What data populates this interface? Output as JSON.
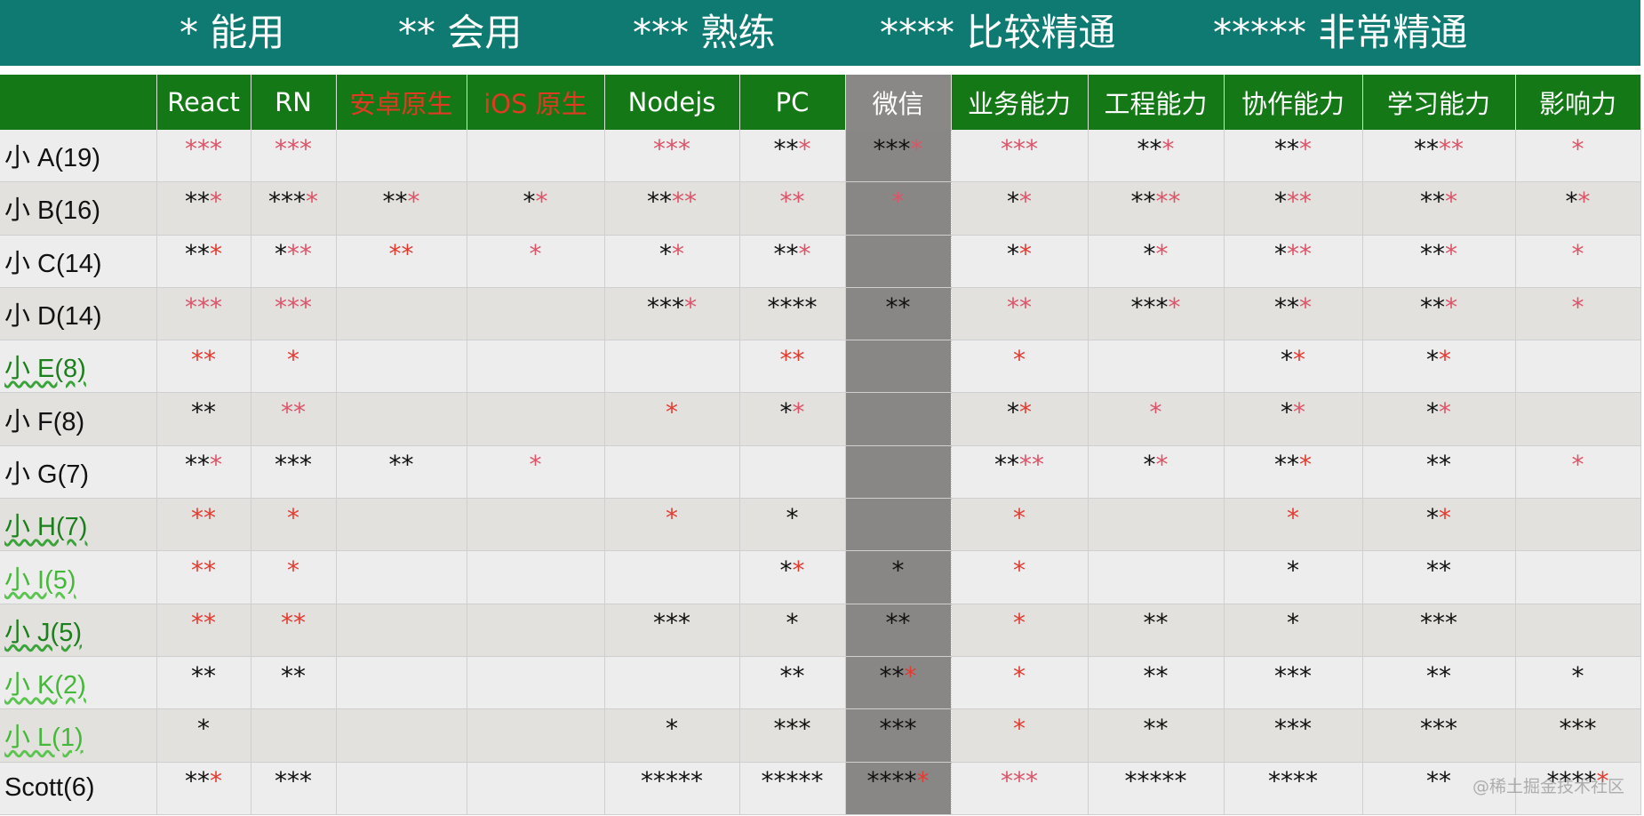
{
  "legend": [
    "* 能用",
    "** 会用",
    "*** 熟练",
    "**** 比较精通",
    "***** 非常精通"
  ],
  "columns": [
    {
      "label": "",
      "color": "white"
    },
    {
      "label": "React",
      "color": "white"
    },
    {
      "label": "RN",
      "color": "white"
    },
    {
      "label": "安卓原生",
      "color": "red"
    },
    {
      "label": "iOS 原生",
      "color": "red"
    },
    {
      "label": "Nodejs",
      "color": "white"
    },
    {
      "label": "PC",
      "color": "white"
    },
    {
      "label": "微信",
      "color": "white"
    },
    {
      "label": "业务能力",
      "color": "white"
    },
    {
      "label": "工程能力",
      "color": "white"
    },
    {
      "label": "协作能力",
      "color": "white"
    },
    {
      "label": "学习能力",
      "color": "white"
    },
    {
      "label": "影响力",
      "color": "white"
    }
  ],
  "star_color_legend": {
    "b": "#111111",
    "r": "#e33b30",
    "p": "#dc5468"
  },
  "rows": [
    {
      "name": "小 A(19)",
      "name_style": "black",
      "cells": [
        "ppp",
        "ppp",
        "",
        "",
        "ppp",
        "bbp",
        "bbbp",
        "ppp",
        "bbp",
        "bbp",
        "bbpp",
        "p"
      ]
    },
    {
      "name": "小 B(16)",
      "name_style": "black",
      "cells": [
        "bbp",
        "bbbp",
        "bbp",
        "bp",
        "bbpp",
        "pp",
        "p",
        "bp",
        "bbpp",
        "bpp",
        "bbp",
        "bp"
      ]
    },
    {
      "name": "小 C(14)",
      "name_style": "black",
      "cells": [
        "bbr",
        "bpp",
        "rr",
        "p",
        "bp",
        "bbp",
        "",
        "br",
        "bp",
        "bpp",
        "bbp",
        "p"
      ]
    },
    {
      "name": "小 D(14)",
      "name_style": "black",
      "cells": [
        "ppp",
        "ppp",
        "",
        "",
        "bbbp",
        "bbbb",
        "bb",
        "pp",
        "bbbp",
        "bbp",
        "bbp",
        "p"
      ]
    },
    {
      "name": "小 E(8)",
      "name_style": "green",
      "cells": [
        "rr",
        "r",
        "",
        "",
        "",
        "rr",
        "",
        "r",
        "",
        "br",
        "br",
        ""
      ]
    },
    {
      "name": "小 F(8)",
      "name_style": "black",
      "cells": [
        "bb",
        "pp",
        "",
        "",
        "r",
        "bp",
        "",
        "br",
        "p",
        "bp",
        "bp",
        ""
      ]
    },
    {
      "name": "小 G(7)",
      "name_style": "black",
      "cells": [
        "bbp",
        "bbb",
        "bb",
        "p",
        "",
        "",
        "",
        "bbpp",
        "bp",
        "bbr",
        "bb",
        "p"
      ]
    },
    {
      "name": "小 H(7)",
      "name_style": "green",
      "cells": [
        "rr",
        "r",
        "",
        "",
        "r",
        "b",
        "",
        "r",
        "",
        "r",
        "br",
        ""
      ]
    },
    {
      "name": "小 I(5)",
      "name_style": "lightgreen",
      "cells": [
        "rr",
        "r",
        "",
        "",
        "",
        "br",
        "b",
        "r",
        "",
        "b",
        "bb",
        ""
      ]
    },
    {
      "name": "小 J(5)",
      "name_style": "green",
      "cells": [
        "rr",
        "rr",
        "",
        "",
        "bbb",
        "b",
        "bb",
        "r",
        "bb",
        "b",
        "bbb",
        ""
      ]
    },
    {
      "name": "小 K(2)",
      "name_style": "lightgreen",
      "cells": [
        "bb",
        "bb",
        "",
        "",
        "",
        "bb",
        "bbr",
        "r",
        "bb",
        "bbb",
        "bb",
        "b"
      ]
    },
    {
      "name": "小 L(1)",
      "name_style": "lightgreen",
      "cells": [
        "b",
        "",
        "",
        "",
        "b",
        "bbb",
        "bbb",
        "r",
        "bb",
        "bbb",
        "bbb",
        "bbb"
      ]
    },
    {
      "name": "Scott(6)",
      "name_style": "black",
      "cells": [
        "bbr",
        "bbb",
        "",
        "",
        "bbbbb",
        "bbbbb",
        "bbbbr",
        "ppp",
        "bbbbb",
        "bbbb",
        "bb",
        "bbbbr"
      ]
    }
  ],
  "watermark": "@稀土掘金技术社区"
}
